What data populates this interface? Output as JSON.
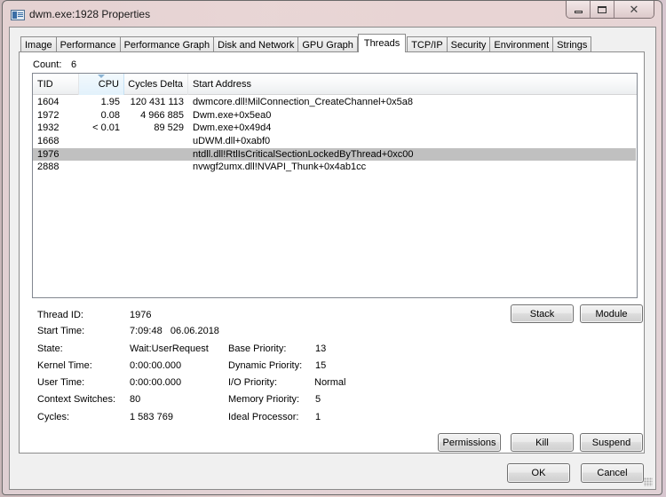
{
  "window": {
    "title": "dwm.exe:1928 Properties",
    "icon": "app-window-icon",
    "caption_buttons": {
      "minimize": "minimize-icon",
      "maximize": "maximize-icon",
      "close": "close-icon",
      "close_glyph": "✕"
    }
  },
  "tabs": [
    {
      "label": "Image",
      "active": false
    },
    {
      "label": "Performance",
      "active": false
    },
    {
      "label": "Performance Graph",
      "active": false
    },
    {
      "label": "Disk and Network",
      "active": false
    },
    {
      "label": "GPU Graph",
      "active": false
    },
    {
      "label": "Threads",
      "active": true
    },
    {
      "label": "TCP/IP",
      "active": false
    },
    {
      "label": "Security",
      "active": false
    },
    {
      "label": "Environment",
      "active": false
    },
    {
      "label": "Strings",
      "active": false
    }
  ],
  "threads": {
    "count_label": "Count:",
    "count_value": "6",
    "columns": [
      "TID",
      "CPU",
      "Cycles Delta",
      "Start Address"
    ],
    "sorted_column": "CPU",
    "rows": [
      {
        "tid": "1604",
        "cpu": "1.95",
        "cycles_delta": "120 431 113",
        "start_address": "dwmcore.dll!MilConnection_CreateChannel+0x5a8",
        "selected": false
      },
      {
        "tid": "1972",
        "cpu": "0.08",
        "cycles_delta": "4 966 885",
        "start_address": "Dwm.exe+0x5ea0",
        "selected": false
      },
      {
        "tid": "1932",
        "cpu": "< 0.01",
        "cycles_delta": "89 529",
        "start_address": "Dwm.exe+0x49d4",
        "selected": false
      },
      {
        "tid": "1668",
        "cpu": "",
        "cycles_delta": "",
        "start_address": "uDWM.dll+0xabf0",
        "selected": false
      },
      {
        "tid": "1976",
        "cpu": "",
        "cycles_delta": "",
        "start_address": "ntdll.dll!RtlIsCriticalSectionLockedByThread+0xc00",
        "selected": true
      },
      {
        "tid": "2888",
        "cpu": "",
        "cycles_delta": "",
        "start_address": "nvwgf2umx.dll!NVAPI_Thunk+0x4ab1cc",
        "selected": false
      }
    ]
  },
  "details": {
    "thread_id": {
      "label": "Thread ID:",
      "value": "1976"
    },
    "start_time": {
      "label": "Start Time:",
      "value": "7:09:48   06.06.2018"
    },
    "state": {
      "label": "State:",
      "value": "Wait:UserRequest"
    },
    "kernel_time": {
      "label": "Kernel Time:",
      "value": "0:00:00.000"
    },
    "user_time": {
      "label": "User Time:",
      "value": "0:00:00.000"
    },
    "context_switches": {
      "label": "Context Switches:",
      "value": "80"
    },
    "cycles": {
      "label": "Cycles:",
      "value": "1 583 769"
    },
    "base_priority": {
      "label": "Base Priority:",
      "value": "13"
    },
    "dynamic_priority": {
      "label": "Dynamic Priority:",
      "value": "15"
    },
    "io_priority": {
      "label": "I/O Priority:",
      "value": "Normal"
    },
    "memory_priority": {
      "label": "Memory Priority:",
      "value": "5"
    },
    "ideal_processor": {
      "label": "Ideal Processor:",
      "value": "1"
    }
  },
  "buttons": {
    "stack": "Stack",
    "module": "Module",
    "permissions": "Permissions",
    "kill": "Kill",
    "suspend": "Suspend",
    "ok": "OK",
    "cancel": "Cancel"
  }
}
